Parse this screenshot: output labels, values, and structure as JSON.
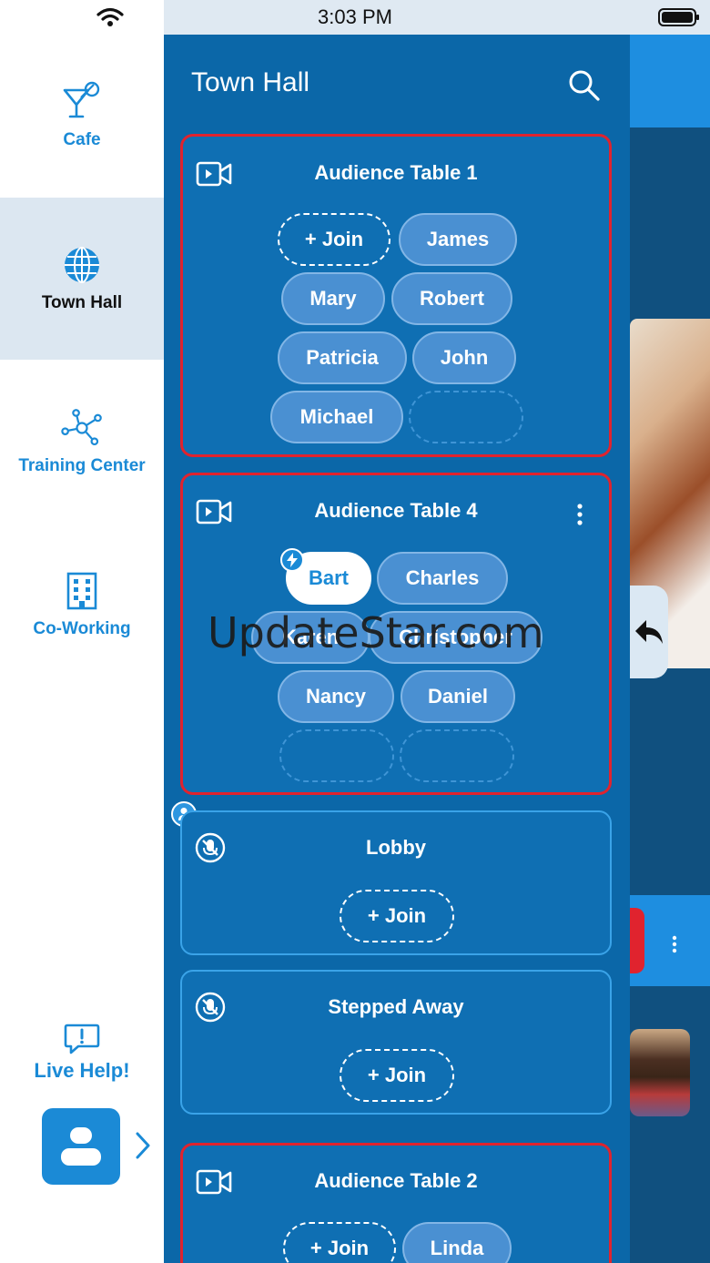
{
  "status_bar": {
    "time": "3:03 PM",
    "icons": [
      "wifi-icon",
      "battery-icon"
    ]
  },
  "sidebar": {
    "items": [
      {
        "label": "Cafe",
        "icon": "cocktail-icon"
      },
      {
        "label": "Town Hall",
        "icon": "globe-icon",
        "active": true
      },
      {
        "label": "Training Center",
        "icon": "network-icon"
      },
      {
        "label": "Co-Working",
        "icon": "building-icon"
      }
    ],
    "live_help": {
      "label": "Live Help!",
      "icon": "chat-alert-icon"
    },
    "profile": {
      "icon": "user-icon",
      "chevron": "chevron-right-icon"
    }
  },
  "panel": {
    "title": "Town Hall",
    "search_icon": "search-icon",
    "tables": [
      {
        "title": "Audience Table 1",
        "join_label": "+ Join",
        "people": [
          "James",
          "Mary",
          "Robert",
          "Patricia",
          "John",
          "Michael"
        ]
      },
      {
        "title": "Audience Table 4",
        "people": [
          "Bart",
          "Charles",
          "Karen",
          "Christopher",
          "Nancy",
          "Daniel"
        ]
      },
      {
        "title": "Lobby",
        "join_label": "+ Join"
      },
      {
        "title": "Stepped Away",
        "join_label": "+ Join"
      },
      {
        "title": "Audience Table 2",
        "join_label": "+ Join",
        "people": [
          "Linda"
        ]
      }
    ]
  },
  "watermark": "UpdateStar.com",
  "colors": {
    "accent": "#1a8ad6",
    "panel": "#0b67a8",
    "card_border_active": "#e0232e",
    "card_border": "#3aa3e8"
  }
}
